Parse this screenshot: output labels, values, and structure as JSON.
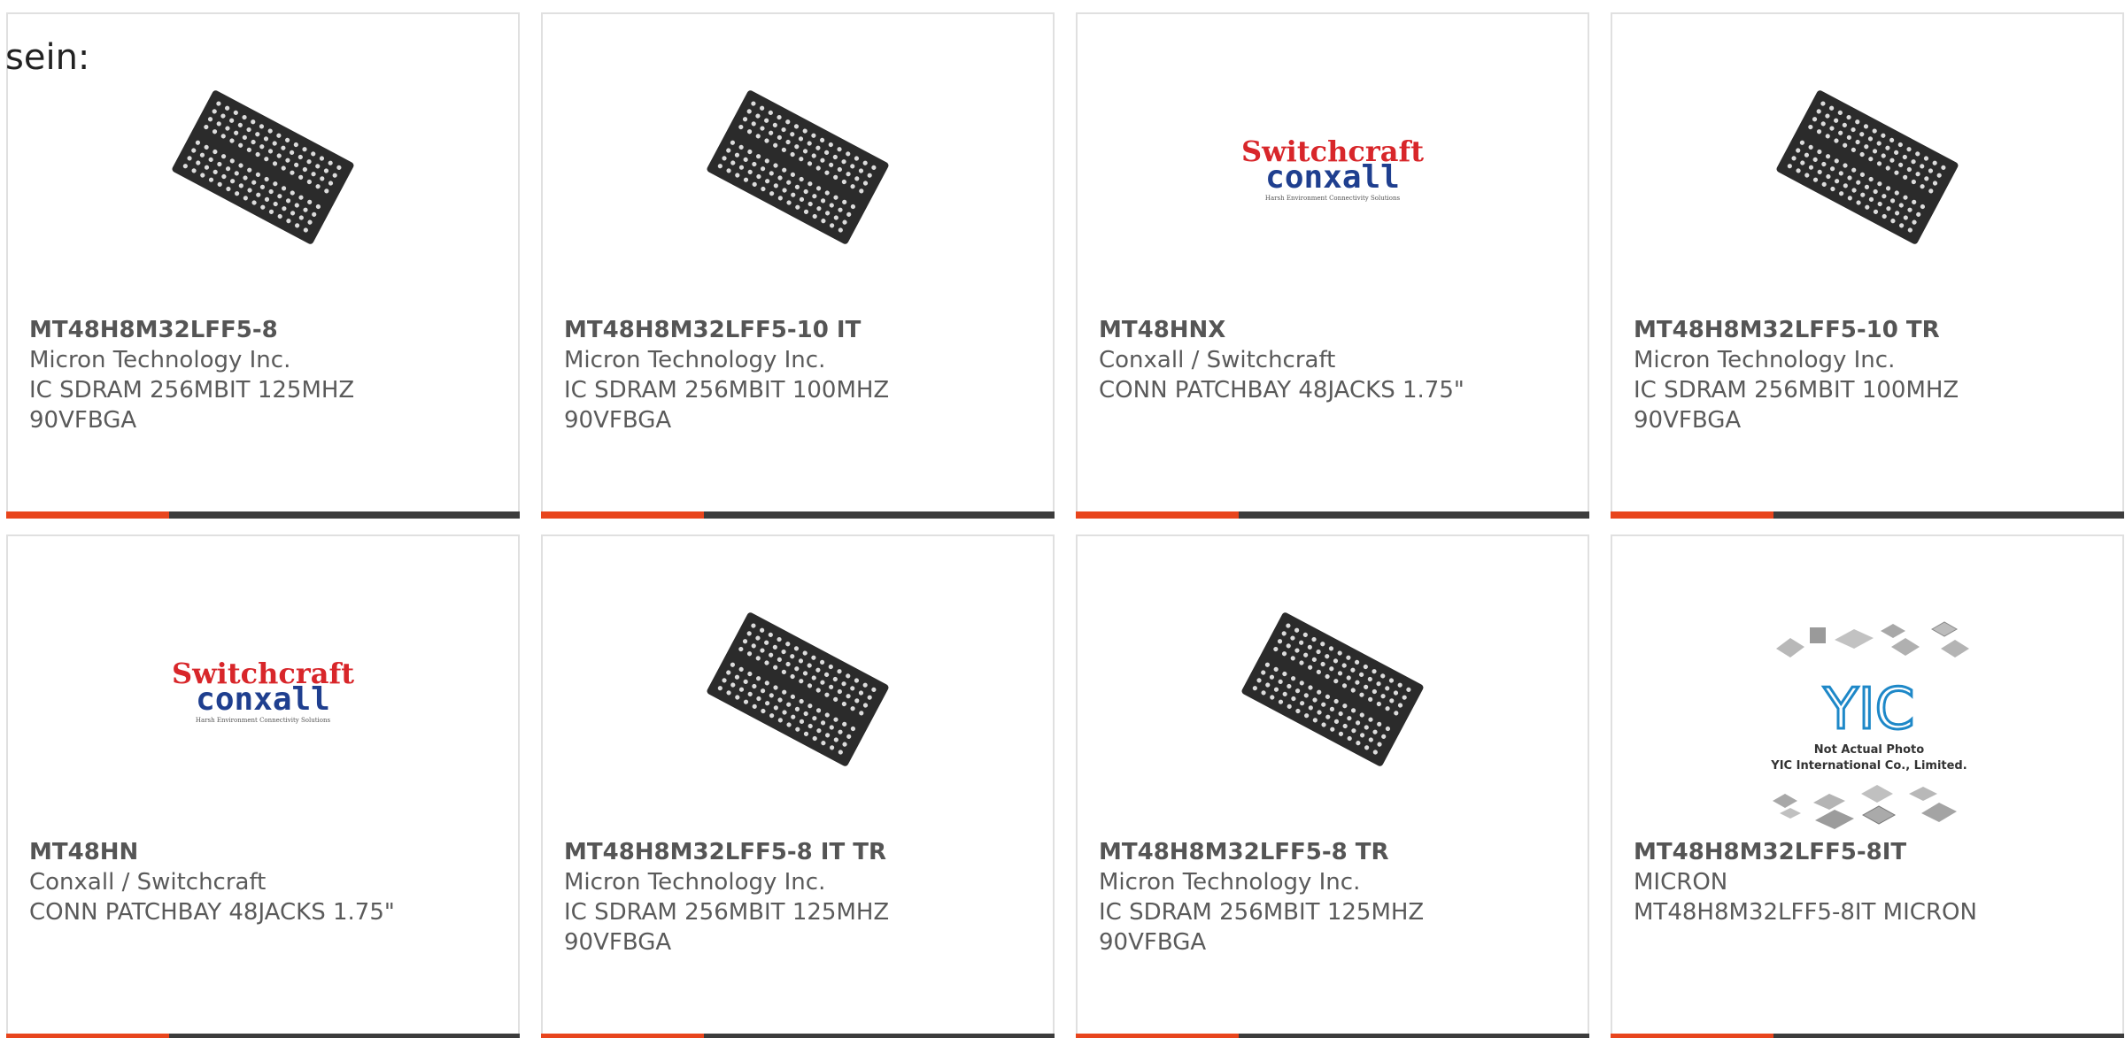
{
  "intro_text": "sein:",
  "colors": {
    "accent": "#e8451d",
    "bar": "#3c3c3c",
    "border": "#e0e0e0",
    "text": "#5a5a5a"
  },
  "products": [
    {
      "title": "MT48H8M32LFF5-8",
      "maker": "Micron Technology Inc.",
      "desc1": "IC SDRAM 256MBIT 125MHZ",
      "desc2": "90VFBGA",
      "image": "bga-chip-icon"
    },
    {
      "title": "MT48H8M32LFF5-10 IT",
      "maker": "Micron Technology Inc.",
      "desc1": "IC SDRAM 256MBIT 100MHZ",
      "desc2": "90VFBGA",
      "image": "bga-chip-icon"
    },
    {
      "title": "MT48HNX",
      "maker": "Conxall / Switchcraft",
      "desc1": "CONN PATCHBAY 48JACKS 1.75\"",
      "desc2": "",
      "image": "switchcraft-conxall-logo",
      "logo": {
        "line1": "Switchcraft",
        "line2": "conxall",
        "tagline": "Harsh Environment Connectivity Solutions"
      }
    },
    {
      "title": "MT48H8M32LFF5-10 TR",
      "maker": "Micron Technology Inc.",
      "desc1": "IC SDRAM 256MBIT 100MHZ",
      "desc2": "90VFBGA",
      "image": "bga-chip-icon"
    },
    {
      "title": "MT48HN",
      "maker": "Conxall / Switchcraft",
      "desc1": "CONN PATCHBAY 48JACKS 1.75\"",
      "desc2": "",
      "image": "switchcraft-conxall-logo",
      "logo": {
        "line1": "Switchcraft",
        "line2": "conxall",
        "tagline": "Harsh Environment Connectivity Solutions"
      }
    },
    {
      "title": "MT48H8M32LFF5-8 IT TR",
      "maker": "Micron Technology Inc.",
      "desc1": "IC SDRAM 256MBIT 125MHZ",
      "desc2": "90VFBGA",
      "image": "bga-chip-icon"
    },
    {
      "title": "MT48H8M32LFF5-8 TR",
      "maker": "Micron Technology Inc.",
      "desc1": "IC SDRAM 256MBIT 125MHZ",
      "desc2": "90VFBGA",
      "image": "bga-chip-icon"
    },
    {
      "title": "MT48H8M32LFF5-8IT",
      "maker": "MICRON",
      "desc1": "MT48H8M32LFF5-8IT MICRON",
      "desc2": "",
      "image": "yic-placeholder-image",
      "placeholder": {
        "brand": "YIC",
        "note1": "Not Actual Photo",
        "note2": "YIC International Co., Limited."
      }
    }
  ]
}
